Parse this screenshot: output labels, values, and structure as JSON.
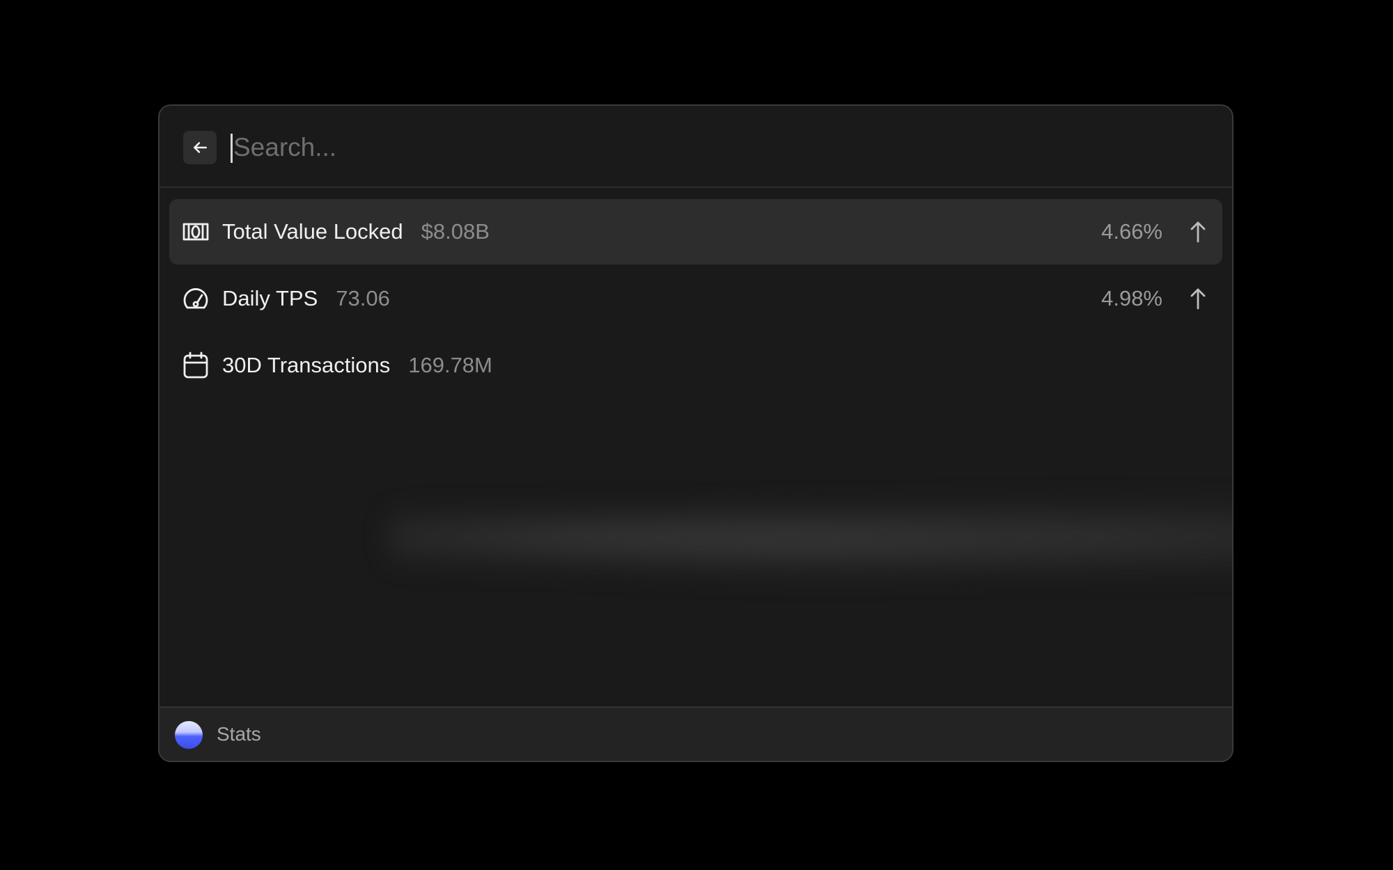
{
  "search": {
    "placeholder": "Search..."
  },
  "items": [
    {
      "title": "Total Value Locked",
      "value": "$8.08B",
      "change": "4.66%",
      "trend": "up",
      "icon": "money-bill-icon",
      "selected": true
    },
    {
      "title": "Daily TPS",
      "value": "73.06",
      "change": "4.98%",
      "trend": "up",
      "icon": "gauge-icon",
      "selected": false
    },
    {
      "title": "30D Transactions",
      "value": "169.78M",
      "change": "",
      "trend": "",
      "icon": "calendar-icon",
      "selected": false
    }
  ],
  "footer": {
    "label": "Stats",
    "logo": "app-logo"
  },
  "colors": {
    "background": "#000000",
    "window": "#1a1a1a",
    "selected_row": "#2d2d2d",
    "footer": "#232323",
    "logo_blue": "#4f62ff"
  }
}
